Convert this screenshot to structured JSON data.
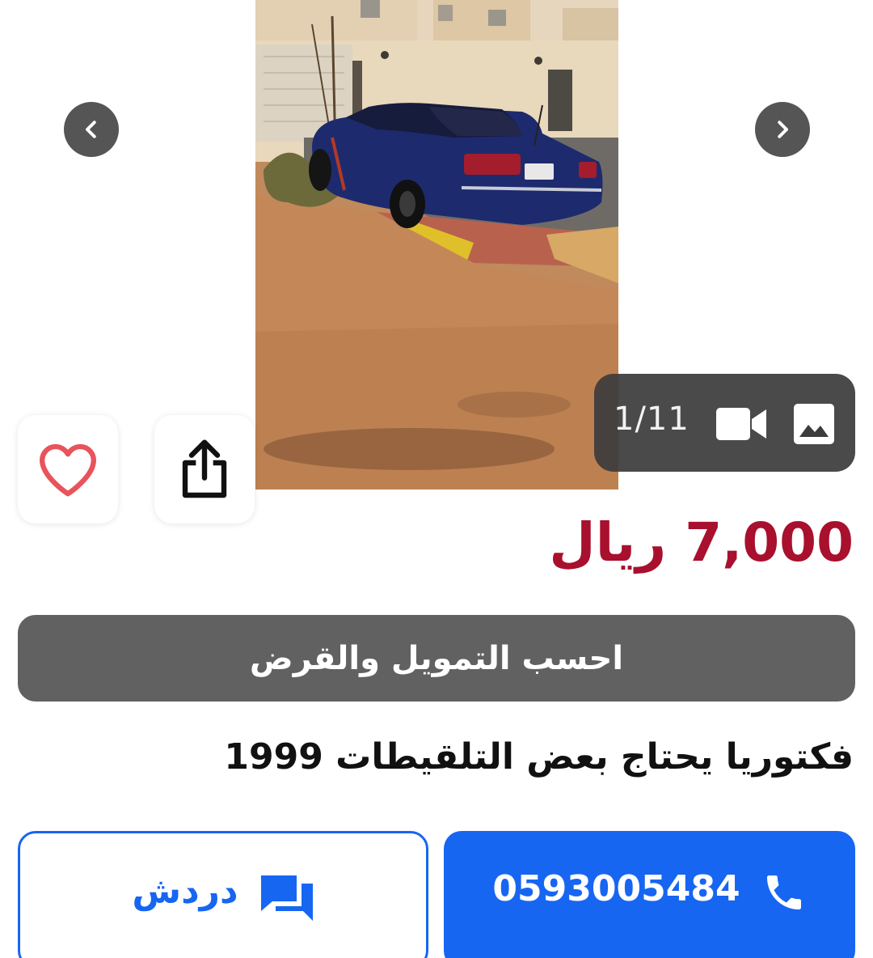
{
  "listing": {
    "image_counter": "1/11",
    "price": "7,000",
    "currency": "ريال",
    "finance_label": "احسب التمويل والقرض",
    "title": "فكتوريا يحتاج بعض التلقيطات 1999"
  },
  "actions": {
    "chat_label": "دردش",
    "phone_number": "0593005484"
  },
  "colors": {
    "price": "#a8102e",
    "primary_blue": "#1766f2",
    "finance_bg": "#616161",
    "favorite_red": "#e8535c"
  },
  "icons": {
    "prev": "chevron-left-icon",
    "next": "chevron-right-icon",
    "video": "video-camera-icon",
    "image": "image-icon",
    "favorite": "heart-icon",
    "share": "share-icon",
    "chat": "chat-icon",
    "phone": "phone-icon"
  }
}
